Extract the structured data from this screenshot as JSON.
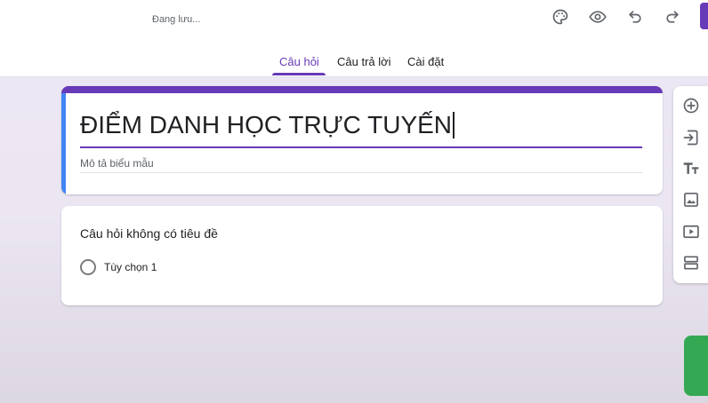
{
  "header": {
    "saving_status": "Đang lưu...",
    "icons": {
      "palette": "palette-icon",
      "preview": "eye-icon",
      "undo": "undo-icon",
      "redo": "redo-icon"
    }
  },
  "tabs": [
    {
      "label": "Câu hỏi",
      "active": true
    },
    {
      "label": "Câu trả lời",
      "active": false
    },
    {
      "label": "Cài đặt",
      "active": false
    }
  ],
  "form": {
    "title": "ĐIỂM DANH HỌC TRỰC TUYẾN",
    "description_placeholder": "Mô tả biểu mẫu"
  },
  "question": {
    "title": "Câu hỏi không có tiêu đề",
    "options": [
      {
        "label": "Tùy chọn 1"
      }
    ]
  },
  "toolbar": {
    "items": [
      {
        "icon": "add-circle-icon"
      },
      {
        "icon": "import-icon"
      },
      {
        "icon": "title-text-icon"
      },
      {
        "icon": "image-icon"
      },
      {
        "icon": "video-icon"
      },
      {
        "icon": "section-icon"
      }
    ]
  },
  "colors": {
    "accent": "#673ab7",
    "title_left_bar": "#4285f4",
    "green_fab": "#34a853"
  }
}
